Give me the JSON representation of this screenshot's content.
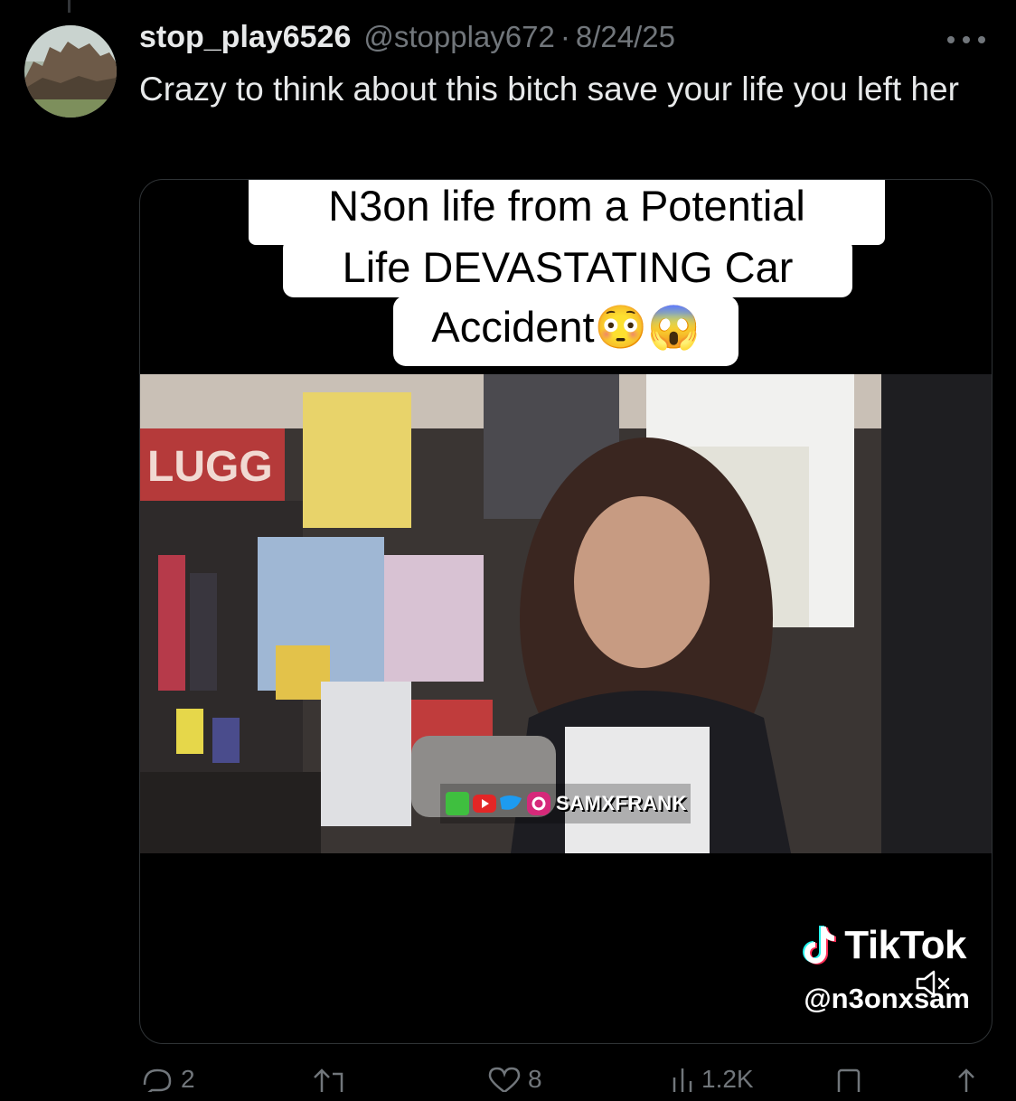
{
  "author": {
    "display_name": "stop_play6526",
    "handle": "@stopplay672",
    "separator": "·",
    "date": "8/24/25"
  },
  "tweet": {
    "text": "Crazy to think about this bitch save your life you left her"
  },
  "media": {
    "caption_line1": "N3on life from a Potential",
    "caption_line2": "Life DEVASTATING Car",
    "caption_line3": "Accident😳😱",
    "watermark_handle": "SAMXFRANK",
    "store_sign": "LUGG",
    "tiktok_word": "TikTok",
    "tiktok_username": "@n3onxsam"
  },
  "actions": {
    "reply_count": "2",
    "like_count": "8",
    "views_count": "1.2K"
  },
  "icons": {
    "more": "more-horizontal-icon",
    "mute": "volume-muted-icon",
    "reply": "reply-icon",
    "retweet": "retweet-icon",
    "like": "heart-icon",
    "views": "views-chart-icon",
    "bookmark": "bookmark-icon",
    "share": "share-icon"
  },
  "colors": {
    "background": "#000000",
    "primary_text": "#e7e9ea",
    "secondary_text": "#71767b",
    "border": "#2f3336"
  }
}
